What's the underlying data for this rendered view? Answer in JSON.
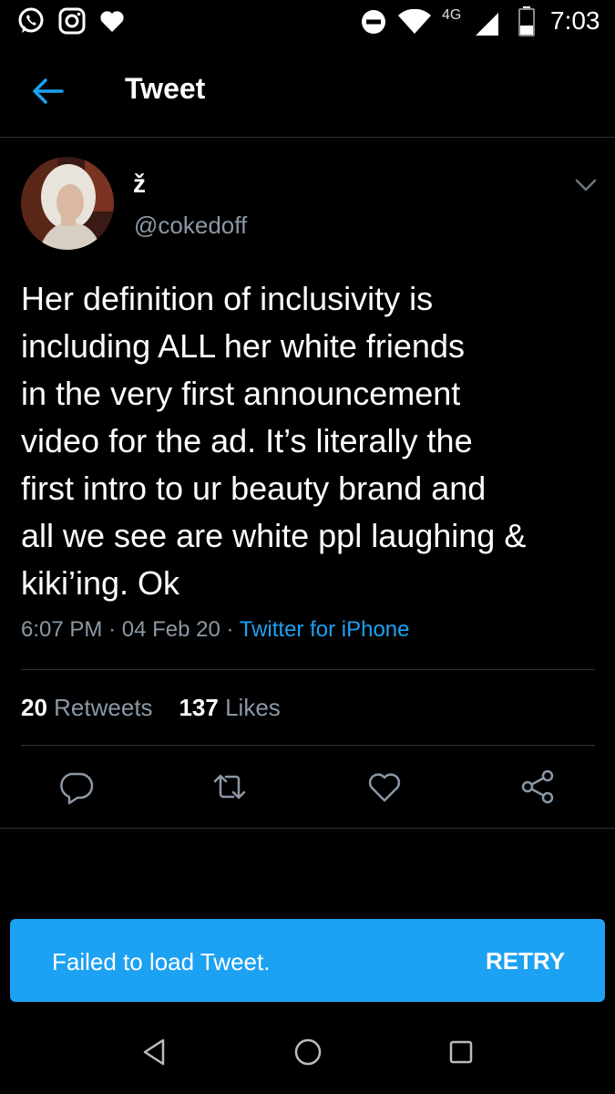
{
  "status_bar": {
    "time": "7:03",
    "network": "4G",
    "icons": [
      "whatsapp-icon",
      "instagram-icon",
      "heart-icon",
      "do-not-disturb-icon",
      "wifi-icon",
      "cell-signal-icon",
      "battery-icon"
    ]
  },
  "header": {
    "back_icon": "arrow-left-icon",
    "title": "Tweet"
  },
  "tweet": {
    "display_name": "ž",
    "handle": "@cokedoff",
    "text": "Her definition of inclusivity is\nincluding ALL her white friends\nin the very first announcement\nvideo for the ad. It’s literally the\nfirst intro to ur beauty brand and\nall we see are white ppl laughing &\nkiki’ing. Ok",
    "time": "6:07 PM",
    "date": "04 Feb 20",
    "separator": "·",
    "source": "Twitter for iPhone",
    "retweets_count": "20",
    "retweets_label": "Retweets",
    "likes_count": "137",
    "likes_label": "Likes"
  },
  "actions": [
    "reply-icon",
    "retweet-icon",
    "like-icon",
    "share-icon"
  ],
  "snackbar": {
    "message": "Failed to load Tweet.",
    "action": "RETRY"
  },
  "nav_bar": [
    "back-triangle-icon",
    "home-circle-icon",
    "recents-square-icon"
  ],
  "colors": {
    "background": "#000000",
    "accent": "#1da1f2",
    "secondary_text": "#8b98a5",
    "divider": "#2f3336"
  }
}
